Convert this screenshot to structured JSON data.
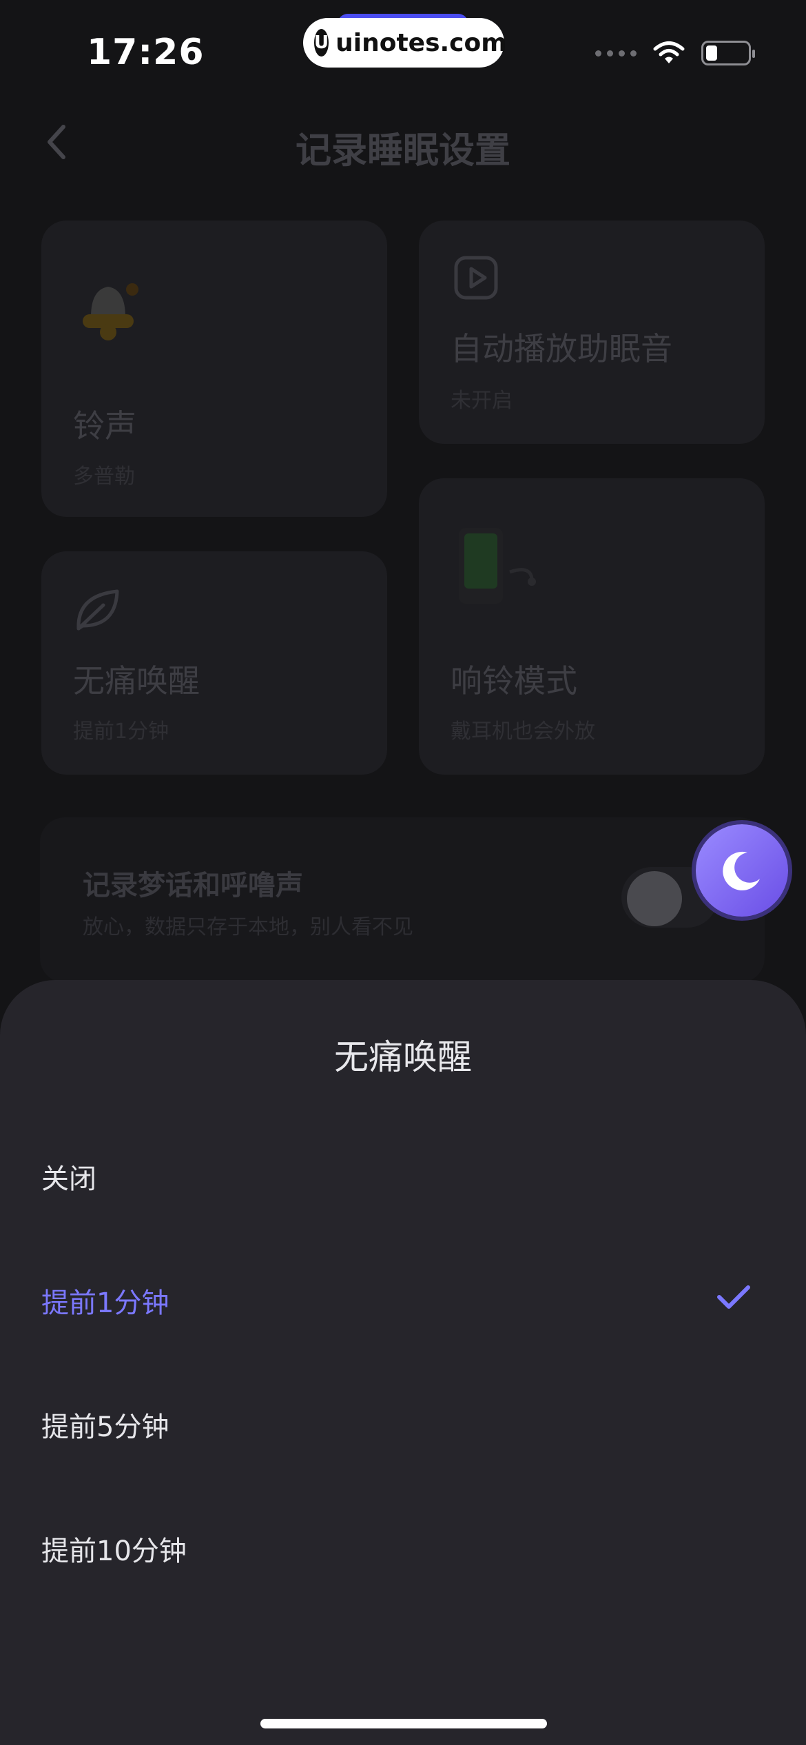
{
  "status_bar": {
    "time": "17:26",
    "watermark": "uinotes.com",
    "watermark_logo": "U"
  },
  "page": {
    "title": "记录睡眠设置",
    "cards": [
      {
        "title": "铃声",
        "subtitle": "多普勒",
        "icon": "bell-icon"
      },
      {
        "title": "自动播放助眠音",
        "subtitle": "未开启",
        "icon": "play-icon"
      },
      {
        "title": "无痛唤醒",
        "subtitle": "提前1分钟",
        "icon": "leaf-icon"
      },
      {
        "title": "响铃模式",
        "subtitle": "戴耳机也会外放",
        "icon": "phone-earphone-icon"
      }
    ],
    "record": {
      "title": "记录梦话和呼噜声",
      "subtitle": "放心，数据只存于本地，别人看不见",
      "enabled": false
    }
  },
  "sheet": {
    "title": "无痛唤醒",
    "options": [
      {
        "label": "关闭",
        "selected": false
      },
      {
        "label": "提前1分钟",
        "selected": true
      },
      {
        "label": "提前5分钟",
        "selected": false
      },
      {
        "label": "提前10分钟",
        "selected": false
      }
    ]
  },
  "colors": {
    "accent": "#7b78ff",
    "sheet_bg": "#26252b",
    "page_bg": "#141416"
  }
}
